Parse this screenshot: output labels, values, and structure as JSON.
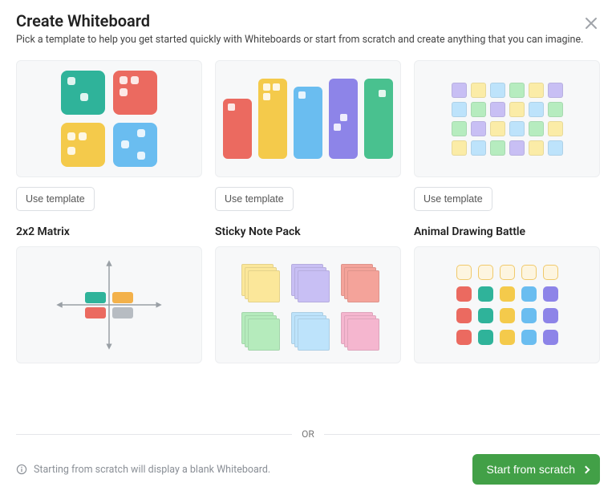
{
  "header": {
    "title": "Create Whiteboard",
    "subtitle": "Pick a template to help you get started quickly with Whiteboards or start from scratch and create anything that you can imagine."
  },
  "templates": {
    "use_template_label": "Use template",
    "items": [
      {
        "title": "2x2 Matrix"
      },
      {
        "title": "Sticky Note Pack"
      },
      {
        "title": "Animal Drawing Battle"
      }
    ]
  },
  "divider": {
    "or": "OR"
  },
  "footer": {
    "scratch_note": "Starting from scratch will display a blank Whiteboard.",
    "scratch_button": "Start from scratch"
  },
  "palette": {
    "teal": "#2fb39a",
    "red": "#eb6a60",
    "yellow": "#f4ca4b",
    "blue": "#6abdf0",
    "purple": "#8d84e8",
    "green": "#5fc77b",
    "lightpurple": "#c8bff4",
    "lightgreen": "#b6ecbf",
    "lightblue": "#bde3fb",
    "lightyellow": "#fbeca7",
    "pink": "#f5a8c5",
    "orange": "#f3b14a",
    "gray": "#b7bcc2"
  }
}
